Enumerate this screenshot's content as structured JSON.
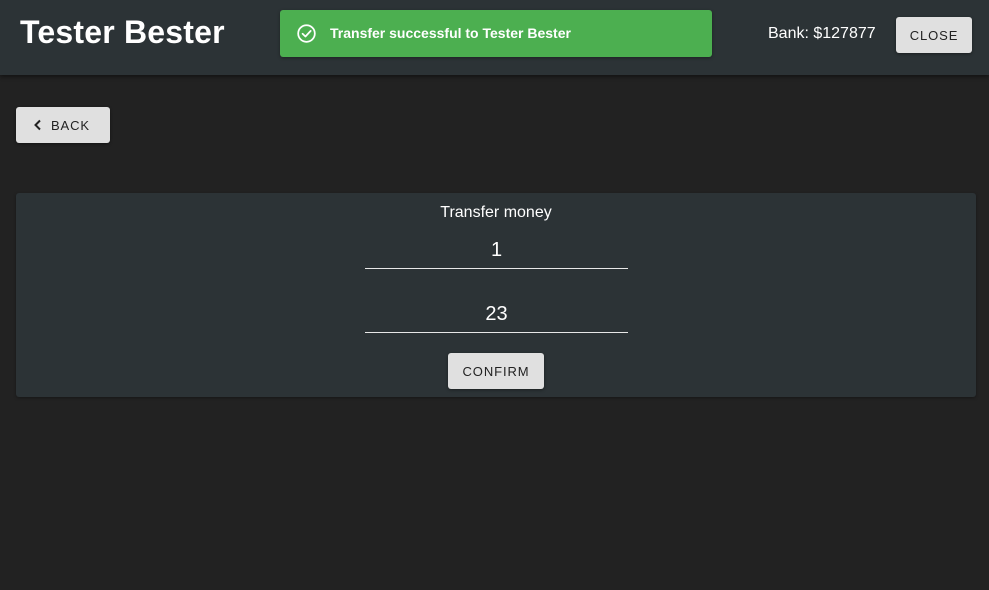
{
  "header": {
    "title": "Tester Bester",
    "bank_text": "Bank: $127877",
    "close_label": "CLOSE"
  },
  "toast": {
    "message": "Transfer successful to Tester Bester",
    "icon": "check-circle-icon",
    "color": "#4caf50"
  },
  "nav": {
    "back_label": "BACK",
    "back_icon": "chevron-left-icon"
  },
  "transfer": {
    "title": "Transfer money",
    "amount_value": "1",
    "account_value": "23",
    "confirm_label": "CONFIRM"
  },
  "colors": {
    "background": "#222222",
    "header": "#2c3336",
    "card": "#2c3336",
    "button": "#e0e0e0",
    "success": "#4caf50"
  }
}
